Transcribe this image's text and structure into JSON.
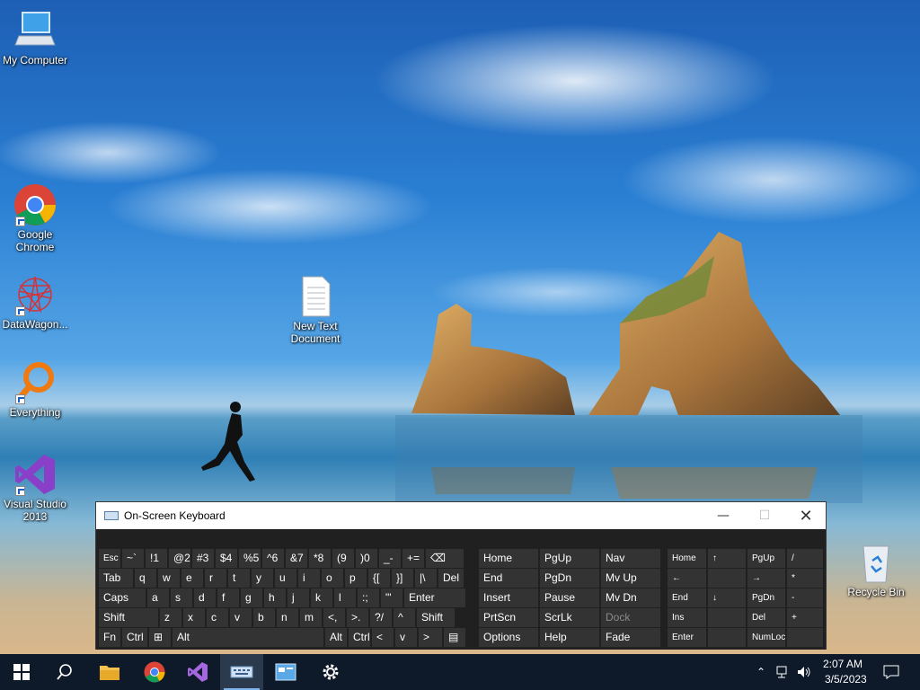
{
  "desktop": {
    "icons": [
      {
        "label": "My Computer"
      },
      {
        "label": "Google Chrome"
      },
      {
        "label": "DataWagon..."
      },
      {
        "label": "Everything"
      },
      {
        "label": "Visual Studio 2013"
      },
      {
        "label": "New Text Document"
      },
      {
        "label": "Recycle Bin"
      }
    ]
  },
  "osk": {
    "title": "On-Screen Keyboard",
    "main_keys": {
      "row1": [
        "Esc",
        "~`",
        "!1",
        "@2",
        "#3",
        "$4",
        "%5",
        "^6",
        "&7",
        "*8",
        "(9",
        ")0",
        "_-",
        "+=",
        "⌫"
      ],
      "row2": [
        "Tab",
        "q",
        "w",
        "e",
        "r",
        "t",
        "y",
        "u",
        "i",
        "o",
        "p",
        "{[",
        "}]",
        "|\\",
        "Del"
      ],
      "row3": [
        "Caps",
        "a",
        "s",
        "d",
        "f",
        "g",
        "h",
        "j",
        "k",
        "l",
        ":;",
        "\"'",
        "Enter"
      ],
      "row4": [
        "Shift",
        "z",
        "x",
        "c",
        "v",
        "b",
        "n",
        "m",
        "<,",
        ">.",
        "?/",
        "^",
        "Shift"
      ],
      "row5": [
        "Fn",
        "Ctrl",
        "⊞",
        "Alt",
        "Alt",
        "Ctrl",
        "<",
        "v",
        ">",
        "▤"
      ]
    },
    "nav_keys": [
      [
        "Home",
        "PgUp",
        "Nav"
      ],
      [
        "End",
        "PgDn",
        "Mv Up"
      ],
      [
        "Insert",
        "Pause",
        "Mv Dn"
      ],
      [
        "PrtScn",
        "ScrLk",
        "Dock"
      ],
      [
        "Options",
        "Help",
        "Fade"
      ]
    ],
    "numpad": [
      [
        "Home",
        "↑",
        "PgUp",
        "/"
      ],
      [
        "←",
        "",
        "→",
        "*"
      ],
      [
        "End",
        "↓",
        "PgDn",
        "-"
      ],
      [
        "Ins",
        "",
        "Del",
        "+"
      ],
      [
        "Enter",
        "",
        "NumLock",
        ""
      ]
    ]
  },
  "taskbar": {
    "time": "2:07 AM",
    "date": "3/5/2023"
  }
}
